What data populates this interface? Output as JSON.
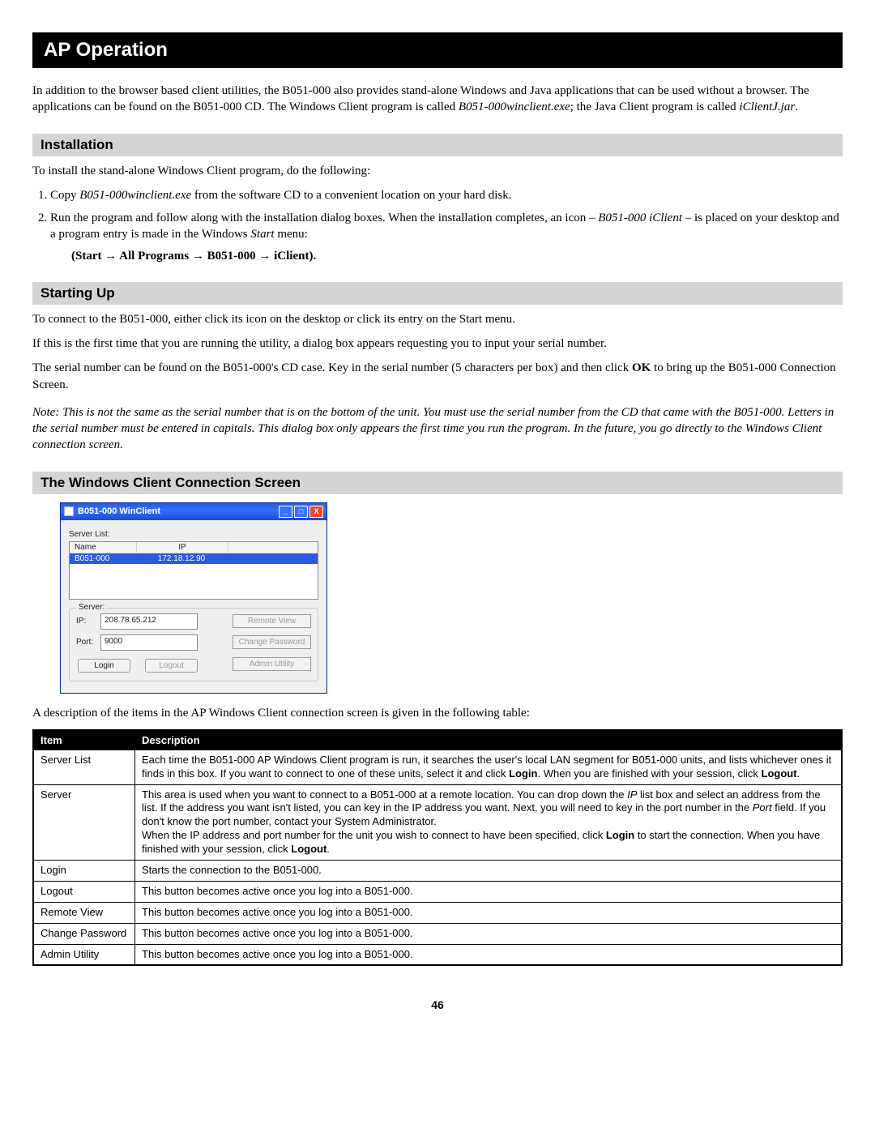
{
  "title": "AP Operation",
  "intro": "In addition to the browser based client utilities, the B051-000 also provides stand-alone Windows and Java applications that can be used without a browser. The applications can be found on the B051-000 CD. The Windows Client program is called ",
  "intro_em1": "B051-000winclient.exe",
  "intro_mid": "; the Java Client program is called ",
  "intro_em2": "iClientJ.jar",
  "intro_end": ".",
  "sections": {
    "install": {
      "head": "Installation",
      "lead": "To install the stand-alone Windows Client program, do the following:",
      "li1a": "Copy ",
      "li1em": "B051-000winclient.exe",
      "li1b": " from the software CD to a convenient location on your hard disk.",
      "li2a": "Run the program and follow along with the installation dialog boxes. When the installation completes, an icon – ",
      "li2em": "B051-000 iClient",
      "li2b": " – is placed on your desktop and a program entry is made in the Windows ",
      "li2em2": "Start",
      "li2c": " menu:",
      "path": "(Start → All Programs → B051-000 → iClient)."
    },
    "start": {
      "head": "Starting Up",
      "p1": "To connect to the B051-000, either click its icon on the desktop or click its entry on the Start menu.",
      "p2": "If this is the first time that you are running the utility, a dialog box appears requesting you to input your serial number.",
      "p3a": "The serial number can be found on the B051-000's CD case. Key in the serial number (5 characters per box) and then click ",
      "p3b": "OK",
      "p3c": " to bring up the B051-000 Connection Screen.",
      "note": "Note: This is not the same as the serial number that is on the bottom of the unit. You must use the serial number from the CD that came with the B051-000. Letters in the serial number must be entered in capitals. This dialog box only appears the first time you run the program. In the future, you go directly to the Windows Client connection screen."
    },
    "conn": {
      "head": "The Windows Client Connection Screen",
      "caption": "A description of the items in the AP Windows Client connection screen is given in the following table:"
    }
  },
  "app": {
    "title": "B051-000 WinClient",
    "serverlist_label": "Server List:",
    "col_name": "Name",
    "col_ip": "IP",
    "row_name": "B051-000",
    "row_ip": "172.18.12.90",
    "server_legend": "Server:",
    "ip_label": "IP:",
    "ip_value": "208.78.65.212",
    "port_label": "Port:",
    "port_value": "9000",
    "btn_remote": "Remote View",
    "btn_change": "Change Password",
    "btn_admin": "Admin Utility",
    "btn_login": "Login",
    "btn_logout": "Logout"
  },
  "table": {
    "h1": "Item",
    "h2": "Description",
    "rows": [
      {
        "item": "Server List",
        "desc": "Each time the B051-000 AP Windows Client program is run, it searches the user's local LAN segment for B051-000 units, and lists whichever ones it finds in this box. If you want to connect to one of these units, select it and click Login. When you are finished with your session, click Logout."
      },
      {
        "item": "Server",
        "desc": "This area is used when you want to connect to a B051-000 at a remote location. You can drop down the IP list box and select an address from the list. If the address you want isn't listed, you can key in the IP address you want. Next, you will need to key in the port number in the Port field. If you don't know the port number, contact your System Administrator.\nWhen the IP address and port number for the unit you wish to connect to have been specified, click Login to start the connection. When you have finished with your session, click Logout."
      },
      {
        "item": "Login",
        "desc": "Starts the connection to the B051-000."
      },
      {
        "item": "Logout",
        "desc": "This button becomes active once you log into a B051-000."
      },
      {
        "item": "Remote View",
        "desc": "This button becomes active once you log into a B051-000."
      },
      {
        "item": "Change Password",
        "desc": "This button becomes active once you log into a B051-000."
      },
      {
        "item": "Admin Utility",
        "desc": "This button becomes active once you log into a B051-000."
      }
    ]
  },
  "page": "46"
}
